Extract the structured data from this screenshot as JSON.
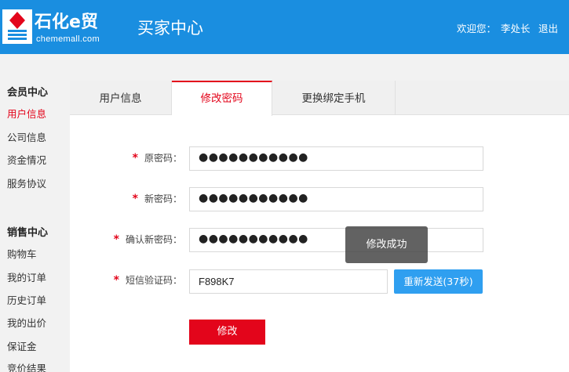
{
  "header": {
    "logo_cn": "石化e贸",
    "logo_en": "chememall.com",
    "title": "买家中心",
    "welcome_prefix": "欢迎您：",
    "user": "李处长",
    "logout": "退出",
    "color": "#1a8ee0"
  },
  "sidebar": {
    "member_title": "会员中心",
    "member_items": [
      "用户信息",
      "公司信息",
      "资金情况",
      "服务协议"
    ],
    "sales_title": "销售中心",
    "sales_items": [
      "购物车",
      "我的订单",
      "历史订单",
      "我的出价",
      "保证金",
      "竞价结果"
    ]
  },
  "tabs": [
    "用户信息",
    "修改密码",
    "更换绑定手机"
  ],
  "active_tab": "修改密码",
  "form": {
    "old_label": "原密码：",
    "old_value": "●●●●●●●●●●●",
    "new_label": "新密码：",
    "new_value": "●●●●●●●●●●●",
    "confirm_label": "确认新密码：",
    "confirm_value": "●●●●●●●●●●●",
    "sms_label": "短信验证码：",
    "sms_value": "F898K7",
    "resend_label": "重新发送(37秒)",
    "submit_label": "修改",
    "required_mark": "*"
  },
  "toast": "修改成功",
  "colors": {
    "accent": "#e3051b",
    "button_blue": "#2f9ff0"
  }
}
